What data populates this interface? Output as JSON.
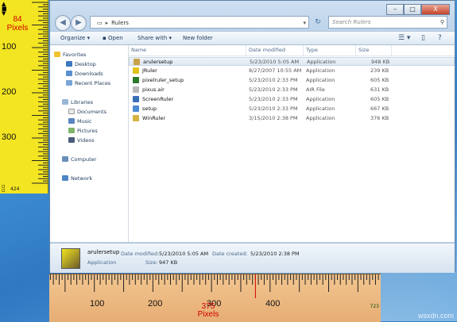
{
  "vertical_ruler": {
    "readout_value": "84",
    "readout_unit": "Pixels",
    "tick_labels": [
      "100",
      "200",
      "300"
    ],
    "end_label": "424"
  },
  "window": {
    "title_buttons": [
      "–",
      "□",
      "X"
    ],
    "address_path": "Rulers",
    "search_placeholder": "Search Rulers",
    "toolbar": {
      "organize": "Organize ▾",
      "open": "Open",
      "share_with": "Share with ▾",
      "new_folder": "New folder"
    },
    "nav": {
      "favorites": "Favorites",
      "desktop": "Desktop",
      "downloads": "Downloads",
      "recent_places": "Recent Places",
      "libraries": "Libraries",
      "documents": "Documents",
      "music": "Music",
      "pictures": "Pictures",
      "videos": "Videos",
      "computer": "Computer",
      "network": "Network"
    },
    "columns": [
      "Name",
      "Date modified",
      "Type",
      "Size"
    ],
    "files": [
      {
        "name": "arulersetup",
        "date": "5/23/2010 5:05 AM",
        "type": "Application",
        "size": "948 KB",
        "color": "#c8a24a"
      },
      {
        "name": "JRuler",
        "date": "8/27/2007 10:55 AM",
        "type": "Application",
        "size": "239 KB",
        "color": "#e3c21a"
      },
      {
        "name": "pixelruler_setup",
        "date": "5/23/2010 2:33 PM",
        "type": "Application",
        "size": "605 KB",
        "color": "#2a7a2a"
      },
      {
        "name": "pixus.air",
        "date": "5/23/2010 2:33 PM",
        "type": "AIR File",
        "size": "631 KB",
        "color": "#b9b9b9"
      },
      {
        "name": "ScreenRuler",
        "date": "5/23/2010 2:33 PM",
        "type": "Application",
        "size": "605 KB",
        "color": "#3a6fb8"
      },
      {
        "name": "setup",
        "date": "5/23/2010 2:33 PM",
        "type": "Application",
        "size": "667 KB",
        "color": "#4a8ad2"
      },
      {
        "name": "WinRuler",
        "date": "3/15/2010 2:38 PM",
        "type": "Application",
        "size": "376 KB",
        "color": "#d6b340"
      }
    ],
    "details": {
      "name": "arulersetup",
      "kind": "Application",
      "date_modified_label": "Date modified:",
      "date_modified": "5/23/2010 5:05 AM",
      "size_label": "Size:",
      "size": "947 KB",
      "date_created_label": "Date created:",
      "date_created": "5/23/2010 2:38 PM"
    }
  },
  "horizontal_ruler": {
    "readout_value": "375",
    "readout_unit": "Pixels",
    "tick_labels": [
      "100",
      "200",
      "300",
      "400"
    ],
    "end_label": "723"
  },
  "watermark": "wsxdn.com"
}
